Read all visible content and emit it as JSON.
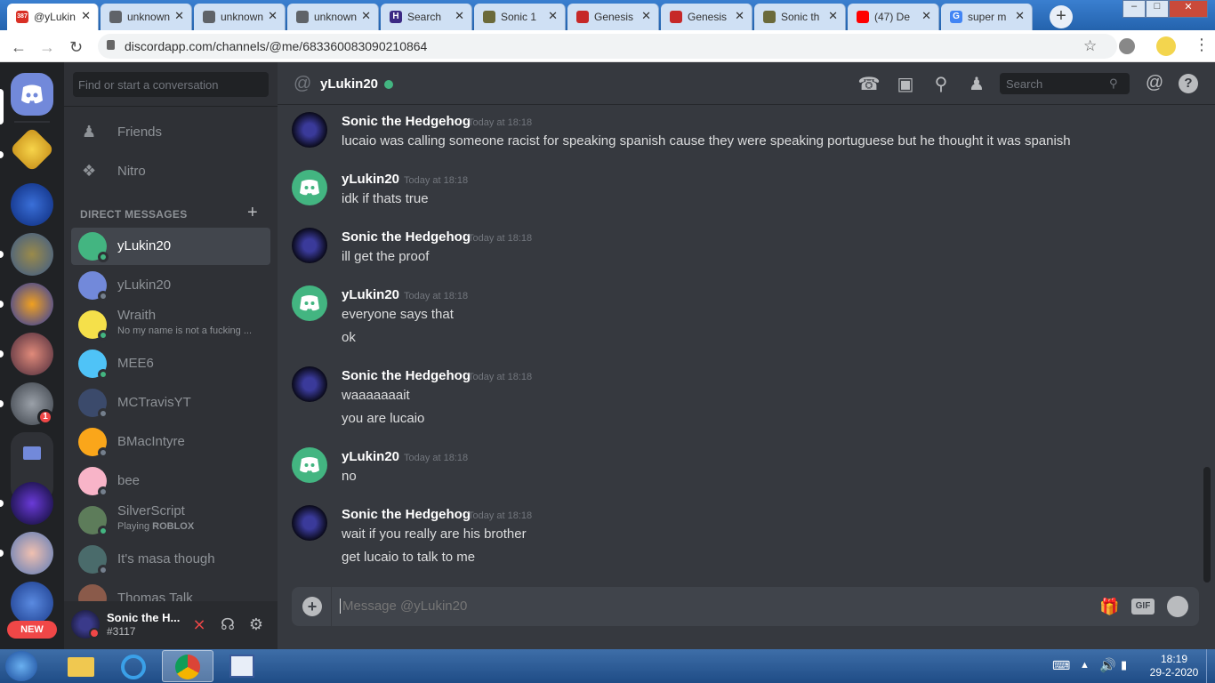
{
  "browser": {
    "tabs": [
      {
        "label": "@yLukin",
        "favicon_color": "#d93025",
        "badge": "387",
        "active": true
      },
      {
        "label": "unknown",
        "favicon_color": "#5f6368",
        "active": false
      },
      {
        "label": "unknown",
        "favicon_color": "#5f6368",
        "active": false
      },
      {
        "label": "unknown",
        "favicon_color": "#5f6368",
        "active": false
      },
      {
        "label": "Search",
        "favicon_color": "#3c2a84",
        "favicon_letter": "H",
        "active": false
      },
      {
        "label": "Sonic 1",
        "favicon_color": "#6b6a3a",
        "active": false
      },
      {
        "label": "Genesis",
        "favicon_color": "#c62828",
        "active": false
      },
      {
        "label": "Genesis",
        "favicon_color": "#c62828",
        "active": false
      },
      {
        "label": "Sonic th",
        "favicon_color": "#6b6a3a",
        "active": false
      },
      {
        "label": "(47) De",
        "favicon_color": "#ff0000",
        "active": false
      },
      {
        "label": "super m",
        "favicon_color": "#4285f4",
        "favicon_letter": "G",
        "active": false
      }
    ],
    "new_tab": "+",
    "url": "discordapp.com/channels/@me/683360083090210864"
  },
  "guilds": {
    "home_icon": "discord-logo-icon",
    "folder_icon": "folder-icon",
    "notification_badge": "1",
    "new_badge": "NEW"
  },
  "sidebar": {
    "search_placeholder": "Find or start a conversation",
    "nav": [
      {
        "label": "Friends",
        "icon": "friends-icon"
      },
      {
        "label": "Nitro",
        "icon": "nitro-icon"
      }
    ],
    "dm_header": "DIRECT MESSAGES",
    "dm_add": "+",
    "dms": [
      {
        "name": "yLukin20",
        "status": "online",
        "avatar_color": "#43b581",
        "selected": true
      },
      {
        "name": "yLukin20",
        "status": "offline",
        "avatar_color": "#7289da"
      },
      {
        "name": "Wraith",
        "sub": "No my name is not a fucking ...",
        "status": "online",
        "avatar_color": "#f5e04a"
      },
      {
        "name": "MEE6",
        "status": "online",
        "avatar_color": "#4fc3f7"
      },
      {
        "name": "MCTravisYT",
        "status": "offline",
        "avatar_color": "#3b4a6b"
      },
      {
        "name": "BMacIntyre",
        "status": "offline",
        "avatar_color": "#faa61a"
      },
      {
        "name": "bee",
        "status": "offline",
        "avatar_color": "#f8b4c8"
      },
      {
        "name": "SilverScript",
        "sub_prefix": "Playing ",
        "sub_bold": "ROBLOX",
        "status": "online",
        "avatar_color": "#5d7c5a"
      },
      {
        "name": "It's masa though",
        "status": "offline",
        "avatar_color": "#4a6b6b"
      },
      {
        "name": "Thomas Talk",
        "status": "offline",
        "avatar_color": "#8a5a4a"
      }
    ]
  },
  "user_panel": {
    "name": "Sonic the H...",
    "tag": "#3117",
    "mute_icon": "mic-muted-icon",
    "deafen_icon": "headphones-icon",
    "settings_icon": "gear-icon"
  },
  "chat": {
    "at_symbol": "@",
    "recipient": "yLukin20",
    "search_placeholder": "Search",
    "messages": [
      {
        "author": "Sonic the Hedgehog",
        "time": "Today at 18:18",
        "lines": [
          "lucaio was calling someone racist for speaking spanish cause they were speaking portuguese but he thought it was spanish"
        ]
      },
      {
        "author": "yLukin20",
        "time": "Today at 18:18",
        "lines": [
          "idk if thats true"
        ]
      },
      {
        "author": "Sonic the Hedgehog",
        "time": "Today at 18:18",
        "lines": [
          "ill get the proof"
        ]
      },
      {
        "author": "yLukin20",
        "time": "Today at 18:18",
        "lines": [
          "everyone says that",
          "ok"
        ]
      },
      {
        "author": "Sonic the Hedgehog",
        "time": "Today at 18:18",
        "lines": [
          "waaaaaaait",
          "you are lucaio"
        ]
      },
      {
        "author": "yLukin20",
        "time": "Today at 18:18",
        "lines": [
          "no"
        ]
      },
      {
        "author": "Sonic the Hedgehog",
        "time": "Today at 18:18",
        "lines": [
          "wait if you really are his brother",
          "get lucaio to talk to me"
        ]
      }
    ],
    "composer_placeholder": "Message @yLukin20",
    "gif_label": "GIF"
  },
  "taskbar": {
    "time": "18:19",
    "date": "29-2-2020"
  },
  "colors": {
    "discord_bg": "#36393f",
    "sidebar_bg": "#2f3136",
    "guild_bg": "#202225",
    "online": "#43b581",
    "blurple": "#7289da"
  }
}
